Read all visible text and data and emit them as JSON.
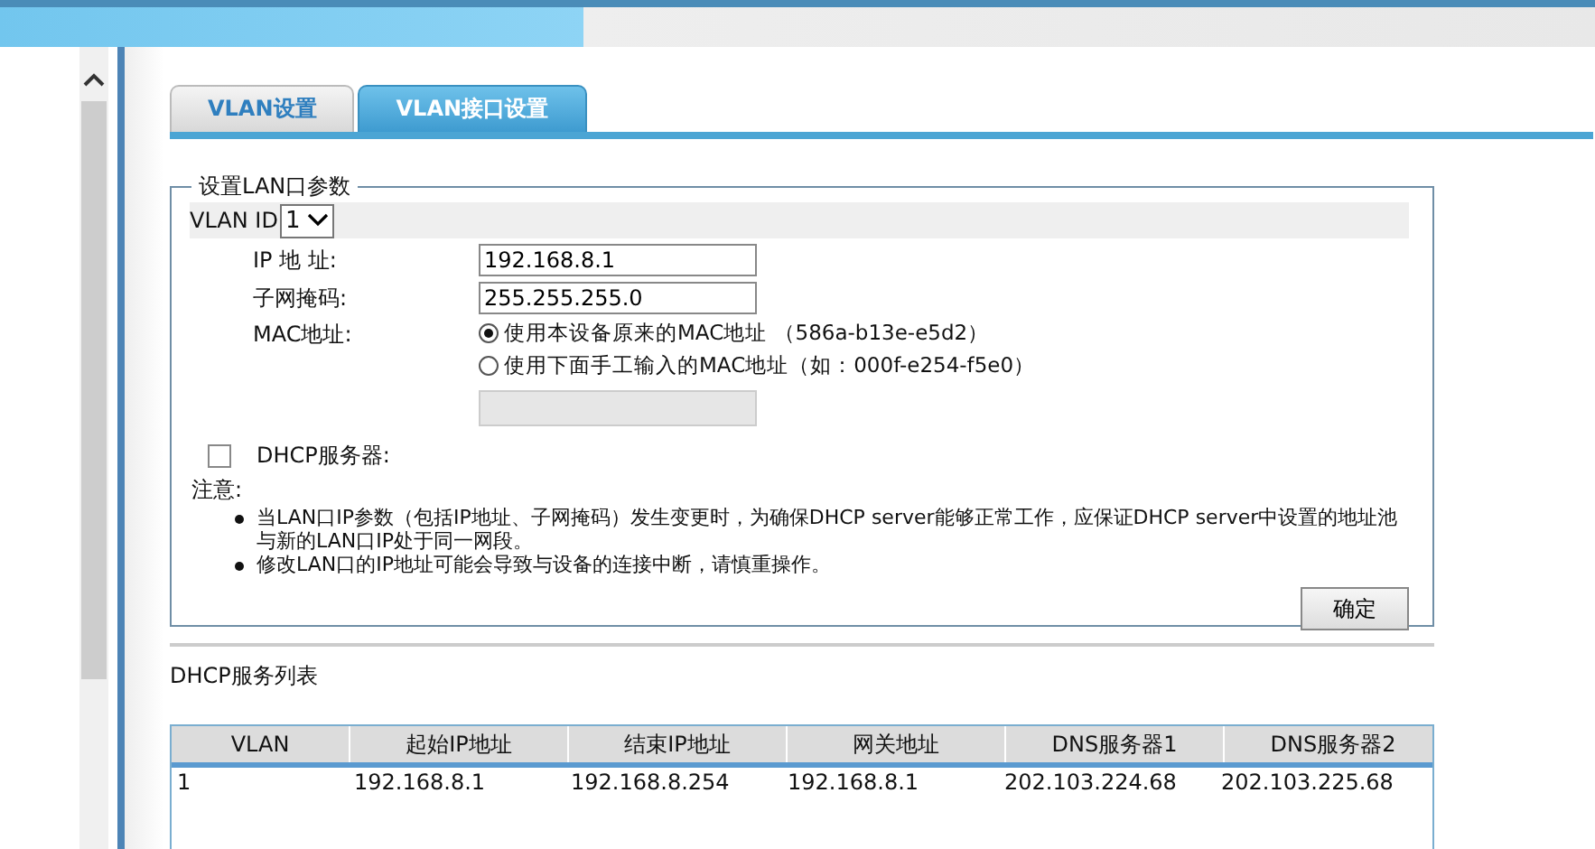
{
  "tabs": [
    {
      "label": "VLAN设置",
      "selected": false
    },
    {
      "label": "VLAN接口设置",
      "selected": true
    }
  ],
  "lan_settings": {
    "legend": "设置LAN口参数",
    "vlan_id_label": "VLAN ID",
    "vlan_id_value": "1",
    "fields": [
      {
        "label": "IP 地 址:",
        "value": "192.168.8.1"
      },
      {
        "label": "子网掩码:",
        "value": "255.255.255.0"
      }
    ],
    "mac_label": "MAC地址:",
    "mac_options": [
      {
        "label": "使用本设备原来的MAC地址 （586a-b13e-e5d2）",
        "selected": true
      },
      {
        "label": "使用下面手工输入的MAC地址（如：000f-e254-f5e0）",
        "selected": false
      }
    ],
    "mac_input_disabled": true,
    "dhcp_server": {
      "label": "DHCP服务器:",
      "checked": false
    },
    "note_title": "注意:",
    "notes": [
      "当LAN口IP参数（包括IP地址、子网掩码）发生变更时，为确保DHCP server能够正常工作，应保证DHCP server中设置的地址池与新的LAN口IP处于同一网段。",
      "修改LAN口的IP地址可能会导致与设备的连接中断，请慎重操作。"
    ],
    "confirm_button": "确定"
  },
  "dhcp_list": {
    "title": "DHCP服务列表",
    "columns": [
      "VLAN",
      "起始IP地址",
      "结束IP地址",
      "网关地址",
      "DNS服务器1",
      "DNS服务器2"
    ],
    "rows": [
      [
        "1",
        "192.168.8.1",
        "192.168.8.254",
        "192.168.8.1",
        "202.103.224.68",
        "202.103.225.68"
      ]
    ]
  }
}
